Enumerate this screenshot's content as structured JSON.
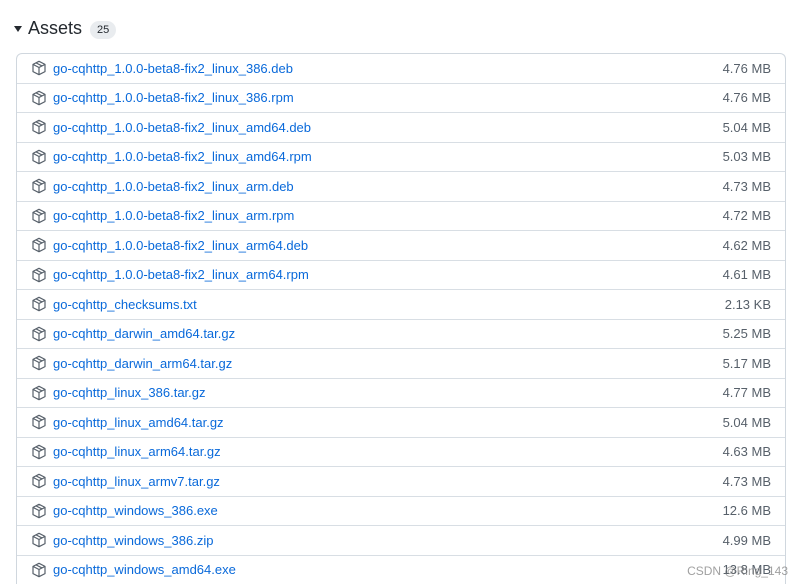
{
  "assets": {
    "title": "Assets",
    "count": "25",
    "items": [
      {
        "name": "go-cqhttp_1.0.0-beta8-fix2_linux_386.deb",
        "size": "4.76 MB"
      },
      {
        "name": "go-cqhttp_1.0.0-beta8-fix2_linux_386.rpm",
        "size": "4.76 MB"
      },
      {
        "name": "go-cqhttp_1.0.0-beta8-fix2_linux_amd64.deb",
        "size": "5.04 MB"
      },
      {
        "name": "go-cqhttp_1.0.0-beta8-fix2_linux_amd64.rpm",
        "size": "5.03 MB"
      },
      {
        "name": "go-cqhttp_1.0.0-beta8-fix2_linux_arm.deb",
        "size": "4.73 MB"
      },
      {
        "name": "go-cqhttp_1.0.0-beta8-fix2_linux_arm.rpm",
        "size": "4.72 MB"
      },
      {
        "name": "go-cqhttp_1.0.0-beta8-fix2_linux_arm64.deb",
        "size": "4.62 MB"
      },
      {
        "name": "go-cqhttp_1.0.0-beta8-fix2_linux_arm64.rpm",
        "size": "4.61 MB"
      },
      {
        "name": "go-cqhttp_checksums.txt",
        "size": "2.13 KB"
      },
      {
        "name": "go-cqhttp_darwin_amd64.tar.gz",
        "size": "5.25 MB"
      },
      {
        "name": "go-cqhttp_darwin_arm64.tar.gz",
        "size": "5.17 MB"
      },
      {
        "name": "go-cqhttp_linux_386.tar.gz",
        "size": "4.77 MB"
      },
      {
        "name": "go-cqhttp_linux_amd64.tar.gz",
        "size": "5.04 MB"
      },
      {
        "name": "go-cqhttp_linux_arm64.tar.gz",
        "size": "4.63 MB"
      },
      {
        "name": "go-cqhttp_linux_armv7.tar.gz",
        "size": "4.73 MB"
      },
      {
        "name": "go-cqhttp_windows_386.exe",
        "size": "12.6 MB"
      },
      {
        "name": "go-cqhttp_windows_386.zip",
        "size": "4.99 MB"
      },
      {
        "name": "go-cqhttp_windows_amd64.exe",
        "size": "13.8 MB"
      }
    ]
  },
  "watermark": "CSDN @Ring_143",
  "icons": {
    "caret": "caret-down-icon",
    "asset": "package-icon"
  },
  "colors": {
    "link": "#0969da",
    "text": "#24292f",
    "muted": "#57606a",
    "border": "#d0d7de"
  }
}
